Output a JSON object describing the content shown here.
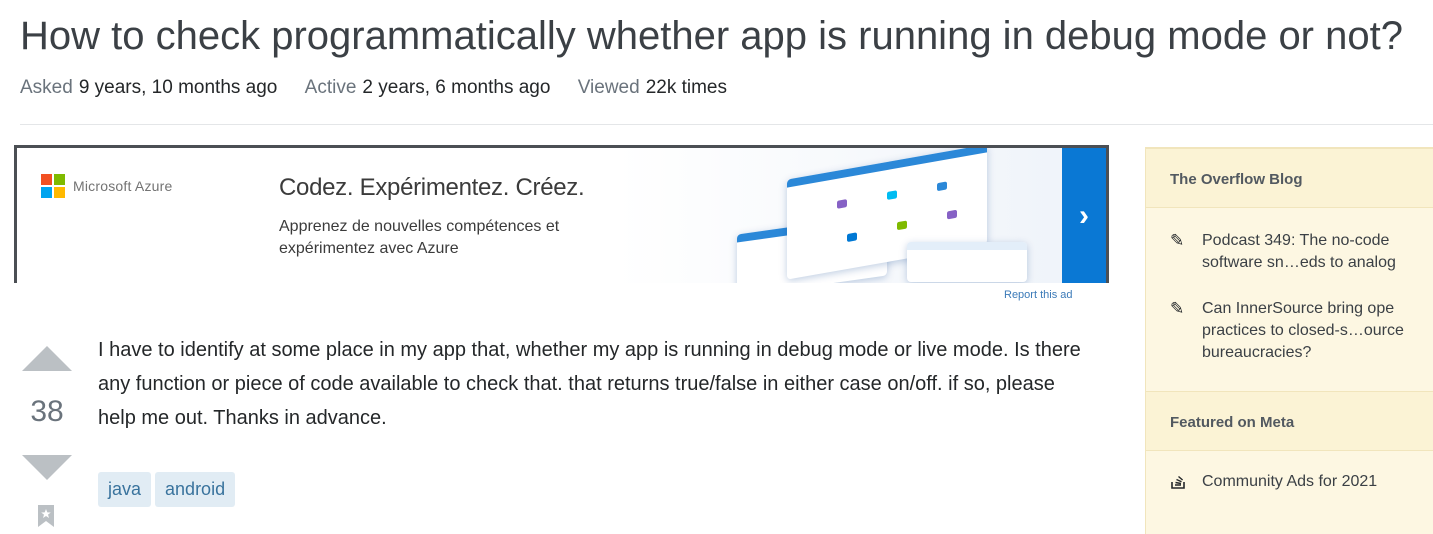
{
  "question": {
    "title": "How to check programmatically whether app is running in debug mode or not?",
    "meta": [
      {
        "label": "Asked",
        "value": "9 years, 10 months ago"
      },
      {
        "label": "Active",
        "value": "2 years, 6 months ago"
      },
      {
        "label": "Viewed",
        "value": "22k times"
      }
    ],
    "votes": "38",
    "body": "I have to identify at some place in my app that, whether my app is running in debug mode or live mode. Is there any function or piece of code available to check that. that returns true/false in either case on/off. if so, please help me out. Thanks in advance.",
    "tags": [
      "java",
      "android"
    ]
  },
  "ad": {
    "brand": "Microsoft Azure",
    "headline": "Codez. Expérimentez. Créez.",
    "body": "Apprenez de nouvelles compétences et expérimentez avec Azure",
    "cta_icon": "chevron-right-icon",
    "report_link": "Report this ad",
    "colors": {
      "accent": "#0a78d4",
      "border": "#4b4f54"
    }
  },
  "sidebar": {
    "blog_header": "The Overflow Blog",
    "blog_items": [
      {
        "icon": "pencil-icon",
        "lines": [
          "Podcast 349: The no-code",
          "software sn…eds to analog"
        ]
      },
      {
        "icon": "pencil-icon",
        "lines": [
          "Can InnerSource bring ope",
          "practices to closed-s…ource",
          "bureaucracies?"
        ]
      }
    ],
    "meta_header": "Featured on Meta",
    "meta_items": [
      {
        "icon": "stack-overflow-icon",
        "lines": [
          "Community Ads for 2021"
        ]
      }
    ],
    "colors": {
      "background": "#fdf7e2",
      "header": "#fbf3d5"
    }
  },
  "colors": {
    "tag_bg": "#e1ecf4",
    "tag_text": "#39739d",
    "vote_arrow": "#bbc0c4"
  }
}
